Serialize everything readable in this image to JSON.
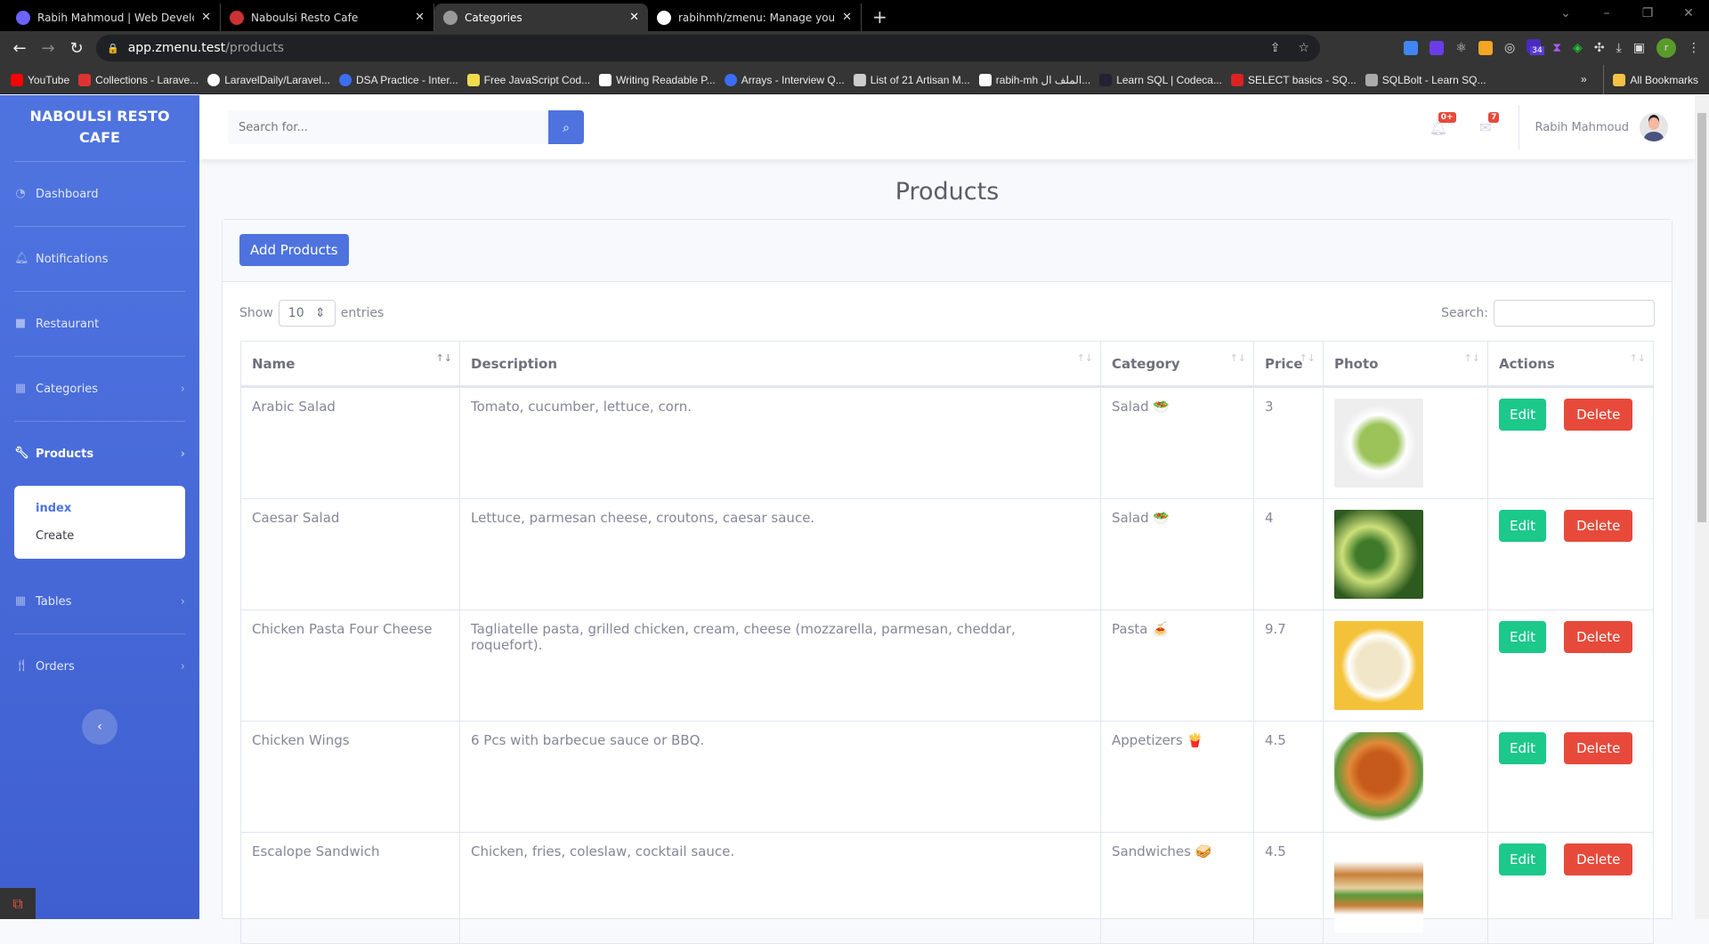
{
  "browser": {
    "tabs": [
      {
        "title": "Rabih Mahmoud | Web Developer",
        "active": false
      },
      {
        "title": "Naboulsi Resto Cafe",
        "active": false
      },
      {
        "title": "Categories",
        "active": true
      },
      {
        "title": "rabihmh/zmenu: Manage your r",
        "active": false
      }
    ],
    "url_host": "app.zmenu.test",
    "url_path": "/products",
    "bookmarks": [
      "YouTube",
      "Collections - Larave...",
      "LaravelDaily/Laravel...",
      "DSA Practice - Inter...",
      "Free JavaScript Cod...",
      "Writing Readable P...",
      "Arrays - Interview Q...",
      "List of 21 Artisan M...",
      "rabih-mh الملف ال...",
      "Learn SQL | Codeca...",
      "SELECT basics - SQ...",
      "SQLBolt - Learn SQ..."
    ],
    "all_bookmarks": "All Bookmarks",
    "profile_initial": "r",
    "ext_badge": "34"
  },
  "sidebar": {
    "brand": "NABOULSI RESTO CAFE",
    "items": [
      {
        "label": "Dashboard",
        "icon": "tachometer-icon"
      },
      {
        "label": "Notifications",
        "icon": "bell-icon"
      },
      {
        "label": "Restaurant",
        "icon": "shopping-bag-icon"
      },
      {
        "label": "Categories",
        "icon": "table-icon"
      },
      {
        "label": "Products",
        "icon": "wrench-icon"
      },
      {
        "label": "Tables",
        "icon": "table-icon"
      },
      {
        "label": "Orders",
        "icon": "utensils-icon"
      }
    ],
    "products_sub": [
      "index",
      "Create"
    ]
  },
  "topbar": {
    "search_placeholder": "Search for...",
    "alerts_badge": "0+",
    "messages_badge": "7",
    "user_name": "Rabih Mahmoud"
  },
  "page": {
    "title": "Products",
    "add_button": "Add Products",
    "show_label": "Show",
    "entries_value": "10",
    "entries_label": "entries",
    "search_label": "Search:",
    "columns": [
      "Name",
      "Description",
      "Category",
      "Price",
      "Photo",
      "Actions"
    ],
    "edit_label": "Edit",
    "delete_label": "Delete",
    "rows": [
      {
        "name": "Arabic Salad",
        "description": "Tomato, cucumber, lettuce, corn.",
        "category": "Salad 🥗",
        "price": "3"
      },
      {
        "name": "Caesar Salad",
        "description": "Lettuce, parmesan cheese, croutons, caesar sauce.",
        "category": "Salad 🥗",
        "price": "4"
      },
      {
        "name": "Chicken Pasta Four Cheese",
        "description": "Tagliatelle pasta, grilled chicken, cream, cheese (mozzarella, parmesan, cheddar, roquefort).",
        "category": "Pasta 🍝",
        "price": "9.7"
      },
      {
        "name": "Chicken Wings",
        "description": "6 Pcs with barbecue sauce or BBQ.",
        "category": "Appetizers 🍟",
        "price": "4.5"
      },
      {
        "name": "Escalope Sandwich",
        "description": "Chicken, fries, coleslaw, cocktail sauce.",
        "category": "Sandwiches 🥪",
        "price": "4.5"
      }
    ]
  }
}
